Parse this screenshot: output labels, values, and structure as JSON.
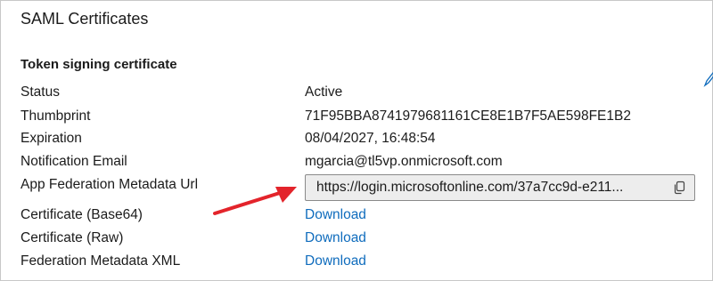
{
  "section": {
    "title": "SAML Certificates"
  },
  "token_signing": {
    "title": "Token signing certificate",
    "rows": [
      {
        "label": "Status",
        "value": "Active"
      },
      {
        "label": "Thumbprint",
        "value": "71F95BBA8741979681161CE8E1B7F5AE598FE1B2"
      },
      {
        "label": "Expiration",
        "value": "08/04/2027, 16:48:54"
      },
      {
        "label": "Notification Email",
        "value": "mgarcia@tl5vp.onmicrosoft.com"
      },
      {
        "label": "App Federation Metadata Url",
        "value": "https://login.microsoftonline.com/37a7cc9d-e211..."
      },
      {
        "label": "Certificate (Base64)",
        "value": "Download"
      },
      {
        "label": "Certificate (Raw)",
        "value": "Download"
      },
      {
        "label": "Federation Metadata XML",
        "value": "Download"
      }
    ]
  },
  "icons": {
    "copy": "copy-icon",
    "edit": "edit-pencil-icon",
    "annotation": "red-arrow"
  },
  "colors": {
    "link": "#0f6cbd",
    "arrow": "#e3242b",
    "input_bg": "#ededed"
  }
}
